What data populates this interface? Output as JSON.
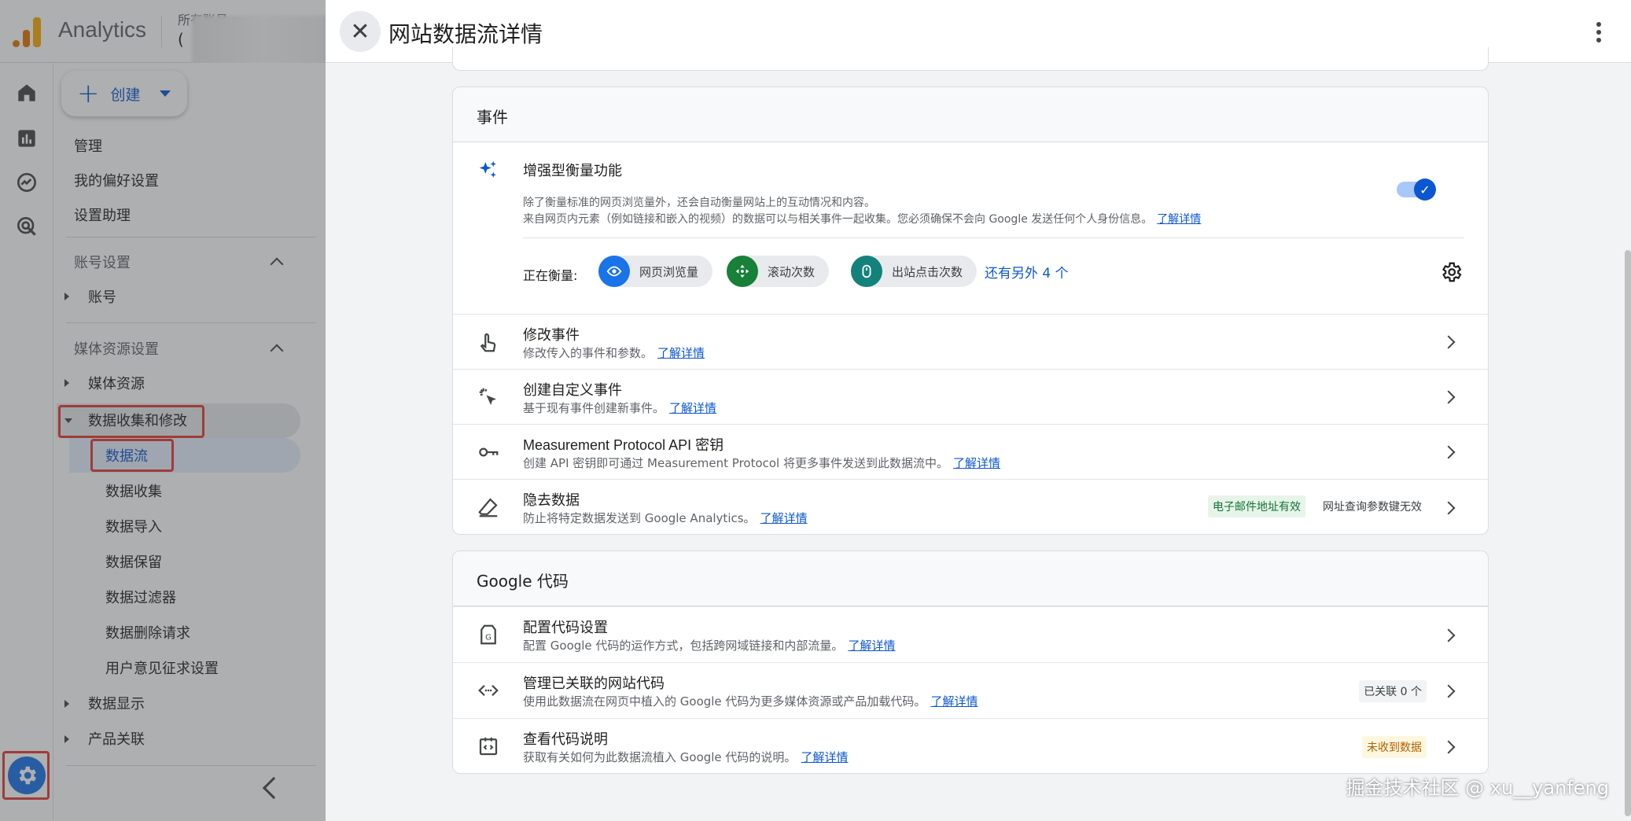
{
  "shell": {
    "app_title": "Analytics",
    "account_crumb": "所有账号 >",
    "account_selected": "(",
    "create_label": "创建",
    "nav_top": [
      "管理",
      "我的偏好设置",
      "设置助理"
    ],
    "section_account": "账号设置",
    "item_account": "账号",
    "section_property": "媒体资源设置",
    "item_property": "媒体资源",
    "item_data_collection_modify": "数据收集和修改",
    "sub_items": [
      "数据流",
      "数据收集",
      "数据导入",
      "数据保留",
      "数据过滤器",
      "数据删除请求",
      "用户意见征求设置"
    ],
    "item_data_display": "数据显示",
    "item_product_links": "产品关联"
  },
  "panel": {
    "title": "网站数据流详情",
    "events_card": {
      "title": "事件",
      "enhanced": {
        "title": "增强型衡量功能",
        "desc1": "除了衡量标准的网页浏览量外，还会自动衡量网站上的互动情况和内容。",
        "desc2": "来自网页内元素（例如链接和嵌入的视频）的数据可以与相关事件一起收集。您必须确保不会向 Google 发送任何个人身份信息。",
        "learn_more": "了解详情",
        "toggle_state": "on",
        "measuring_label": "正在衡量:",
        "chips": [
          "网页浏览量",
          "滚动次数",
          "出站点击次数"
        ],
        "more": "还有另外 4 个"
      },
      "rows": [
        {
          "title": "修改事件",
          "desc": "修改传入的事件和参数。",
          "link": "了解详情"
        },
        {
          "title": "创建自定义事件",
          "desc": "基于现有事件创建新事件。",
          "link": "了解详情"
        },
        {
          "title": "Measurement Protocol API 密钥",
          "desc": "创建 API 密钥即可通过 Measurement Protocol 将更多事件发送到此数据流中。",
          "link": "了解详情"
        },
        {
          "title": "隐去数据",
          "desc": "防止将特定数据发送到 Google Analytics。",
          "link": "了解详情",
          "chip1": "电子邮件地址有效",
          "chip2": "网址查询参数键无效"
        }
      ]
    },
    "tag_card": {
      "title": "Google 代码",
      "rows": [
        {
          "title": "配置代码设置",
          "desc": "配置 Google 代码的运作方式，包括跨网域链接和内部流量。",
          "link": "了解详情"
        },
        {
          "title": "管理已关联的网站代码",
          "desc": "使用此数据流在网页中植入的 Google 代码为更多媒体资源或产品加载代码。",
          "link": "了解详情",
          "chip": "已关联 0 个"
        },
        {
          "title": "查看代码说明",
          "desc": "获取有关如何为此数据流植入 Google 代码的说明。",
          "link": "了解详情",
          "chip": "未收到数据"
        }
      ]
    }
  },
  "watermark": "掘金技术社区 @ xu__yanfeng",
  "colors": {
    "accent": "#0b57d0",
    "highlight_box": "#e53935",
    "chip_green": "#137333",
    "chip_orange": "#b06000"
  }
}
